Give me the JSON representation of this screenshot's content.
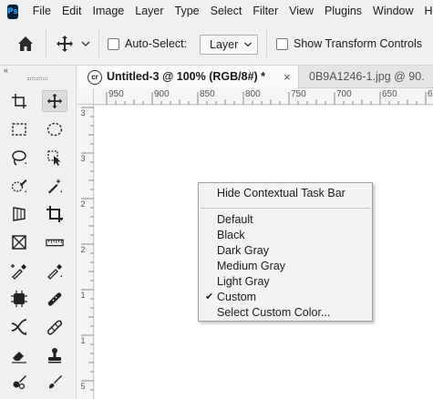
{
  "app": {
    "logo": "Ps"
  },
  "menubar": {
    "items": [
      "File",
      "Edit",
      "Image",
      "Layer",
      "Type",
      "Select",
      "Filter",
      "View",
      "Plugins",
      "Window",
      "Help"
    ]
  },
  "options": {
    "auto_select_label": "Auto-Select:",
    "auto_select_checked": false,
    "layer_select_value": "Layer",
    "show_transform_label": "Show Transform Controls",
    "show_transform_checked": false
  },
  "toolbar": {
    "collapse_glyph": "«",
    "tools": [
      {
        "icon": "artboard-icon"
      },
      {
        "icon": "move-icon",
        "active": true
      },
      {
        "icon": "rectangular-marquee-icon"
      },
      {
        "icon": "elliptical-marquee-icon"
      },
      {
        "icon": "lasso-icon"
      },
      {
        "icon": "object-selection-icon"
      },
      {
        "icon": "quick-selection-icon"
      },
      {
        "icon": "magic-wand-icon"
      },
      {
        "icon": "perspective-crop-icon"
      },
      {
        "icon": "crop-icon"
      },
      {
        "icon": "frame-icon"
      },
      {
        "icon": "ruler-icon"
      },
      {
        "icon": "color-sampler-icon"
      },
      {
        "icon": "eyedropper-icon"
      },
      {
        "icon": "content-aware-move-icon"
      },
      {
        "icon": "spot-healing-brush-icon"
      },
      {
        "icon": "red-eye-icon"
      },
      {
        "icon": "healing-brush-icon"
      },
      {
        "icon": "eraser-icon"
      },
      {
        "icon": "clone-stamp-icon"
      },
      {
        "icon": "mixer-brush-icon"
      },
      {
        "icon": "brush-icon"
      }
    ]
  },
  "tabs": [
    {
      "icon_text": "cr",
      "label": "Untitled-3 @ 100% (RGB/8#) *",
      "close": "×",
      "active": true
    },
    {
      "label": "0B9A1246-1.jpg @ 90.",
      "active": false
    }
  ],
  "rulers": {
    "horizontal": [
      "950",
      "900",
      "850",
      "800",
      "750",
      "700",
      "650",
      "6"
    ],
    "vertical": [
      "3",
      "3",
      "2",
      "2",
      "1",
      "1",
      "5"
    ]
  },
  "context_menu": {
    "items": [
      {
        "label": "Hide Contextual Task Bar"
      },
      {
        "label": "Default"
      },
      {
        "label": "Black"
      },
      {
        "label": "Dark Gray"
      },
      {
        "label": "Medium Gray"
      },
      {
        "label": "Light Gray"
      },
      {
        "label": "Custom",
        "checked": true
      },
      {
        "label": "Select Custom Color..."
      }
    ],
    "check_glyph": "✔"
  }
}
